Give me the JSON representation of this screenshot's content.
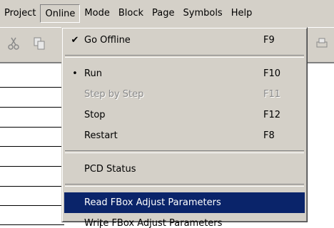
{
  "menubar": {
    "items": [
      "Project",
      "Online",
      "Mode",
      "Block",
      "Page",
      "Symbols",
      "Help"
    ],
    "active": "Online"
  },
  "toolbar": {
    "icons": [
      "cut-icon",
      "copy-icon",
      "print-icon"
    ]
  },
  "dropdown": {
    "go_offline": {
      "label": "Go Offline",
      "shortcut": "F9",
      "mark": "✔"
    },
    "run": {
      "label": "Run",
      "shortcut": "F10",
      "mark": "•"
    },
    "step_by_step": {
      "label": "Step by Step",
      "shortcut": "F11"
    },
    "stop": {
      "label": "Stop",
      "shortcut": "F12"
    },
    "restart": {
      "label": "Restart",
      "shortcut": "F8"
    },
    "pcd_status": {
      "label": "PCD Status"
    },
    "read_fbox": {
      "label": "Read FBox Adjust Parameters"
    },
    "write_fbox": {
      "label": "Write FBox Adjust Parameters"
    }
  },
  "colors": {
    "menu_bg": "#d4d0c8",
    "highlight": "#0a246a",
    "disabled_text": "#8a8a8a"
  }
}
